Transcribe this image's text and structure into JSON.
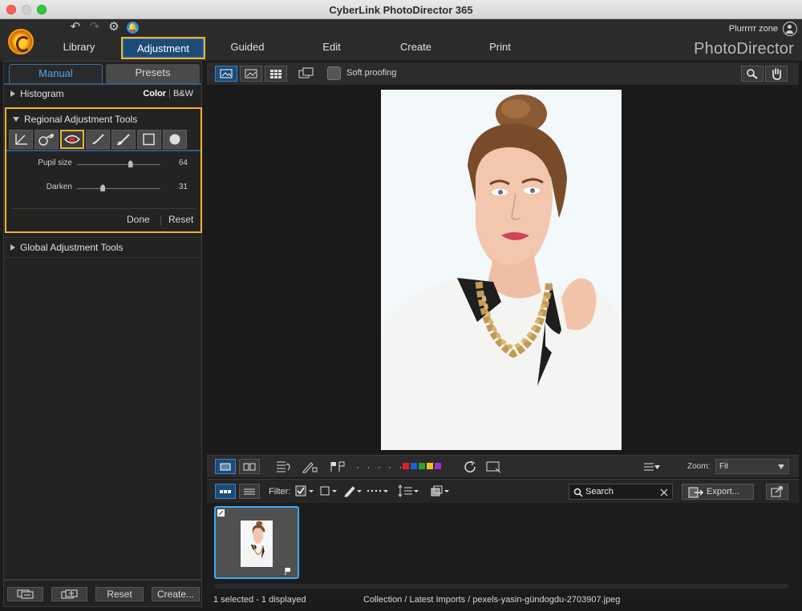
{
  "window": {
    "title": "CyberLink PhotoDirector 365"
  },
  "header": {
    "user_name": "Plurrrrr zone",
    "brand": "PhotoDirector",
    "modules": [
      {
        "label": "Library"
      },
      {
        "label": "Adjustment"
      },
      {
        "label": "Guided"
      },
      {
        "label": "Edit"
      },
      {
        "label": "Create"
      },
      {
        "label": "Print"
      }
    ],
    "active_module": "Adjustment"
  },
  "left_panel": {
    "tabs": [
      {
        "label": "Manual"
      },
      {
        "label": "Presets"
      }
    ],
    "active_tab": "Manual",
    "histogram": {
      "label": "Histogram",
      "color_label": "Color",
      "bw_label": "B&W"
    },
    "regional": {
      "label": "Regional Adjustment Tools",
      "tools": [
        "crop-straighten",
        "spot-removal",
        "red-eye",
        "brush",
        "brush-mask",
        "gradient",
        "radial"
      ],
      "selected_tool": "red-eye",
      "sliders": [
        {
          "label": "Pupil size",
          "value": "64",
          "fraction": 0.64
        },
        {
          "label": "Darken",
          "value": "31",
          "fraction": 0.31
        }
      ],
      "done_label": "Done",
      "reset_label": "Reset"
    },
    "global": {
      "label": "Global Adjustment Tools"
    },
    "bottom": {
      "reset_label": "Reset",
      "create_label": "Create..."
    }
  },
  "viewer": {
    "soft_proofing_label": "Soft proofing",
    "zoom_label": "Zoom:",
    "zoom_value": "Fit",
    "filter_label": "Filter:",
    "search_placeholder": "Search",
    "export_label": "Export...",
    "color_labels": [
      "#e21c1c",
      "#1f5fd6",
      "#29a22c",
      "#f2c21a",
      "#9b30d9"
    ]
  },
  "status": {
    "selection": "1 selected - 1 displayed",
    "path": "Collection / Latest Imports / pexels-yasin-gündogdu-2703907.jpeg"
  }
}
